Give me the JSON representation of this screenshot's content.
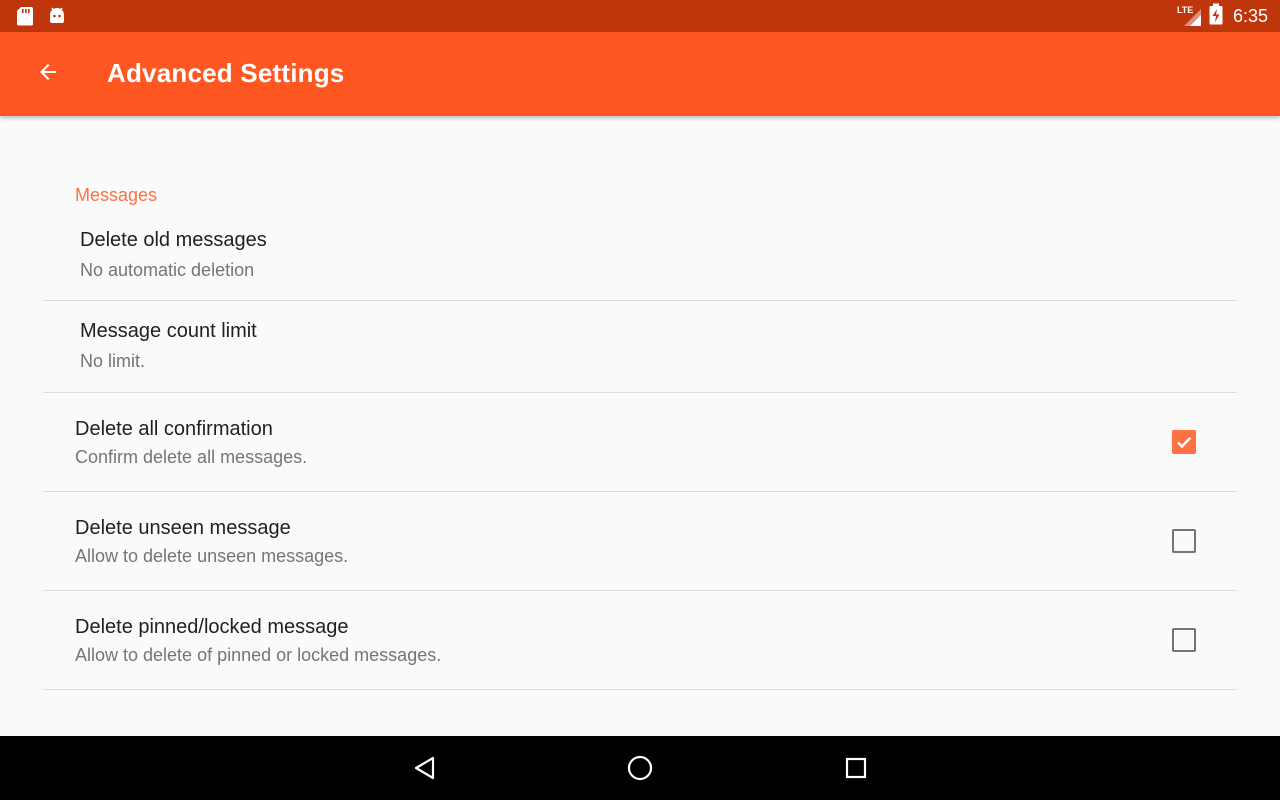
{
  "status_bar": {
    "time": "6:35",
    "network": "LTE",
    "left_icons": [
      "sd-card-icon",
      "android-icon"
    ],
    "right_icons": [
      "signal-icon",
      "battery-charging-icon"
    ]
  },
  "app_bar": {
    "title": "Advanced Settings",
    "back_icon": "arrow-back-icon",
    "color": "#ff5722"
  },
  "colors": {
    "status_bar": "#bf360c",
    "accent": "#ff7043"
  },
  "section": {
    "header": "Messages"
  },
  "preferences": [
    {
      "title": "Delete old messages",
      "summary": "No automatic deletion",
      "type": "list"
    },
    {
      "title": "Message count limit",
      "summary": "No limit.",
      "type": "list"
    },
    {
      "title": "Delete all confirmation",
      "summary": "Confirm delete all messages.",
      "type": "checkbox",
      "checked": true
    },
    {
      "title": "Delete unseen message",
      "summary": "Allow to delete unseen messages.",
      "type": "checkbox",
      "checked": false
    },
    {
      "title": "Delete pinned/locked message",
      "summary": "Allow to delete of pinned or locked messages.",
      "type": "checkbox",
      "checked": false
    }
  ],
  "nav_bar": {
    "buttons": [
      "back-triangle-icon",
      "home-circle-icon",
      "recents-square-icon"
    ]
  }
}
